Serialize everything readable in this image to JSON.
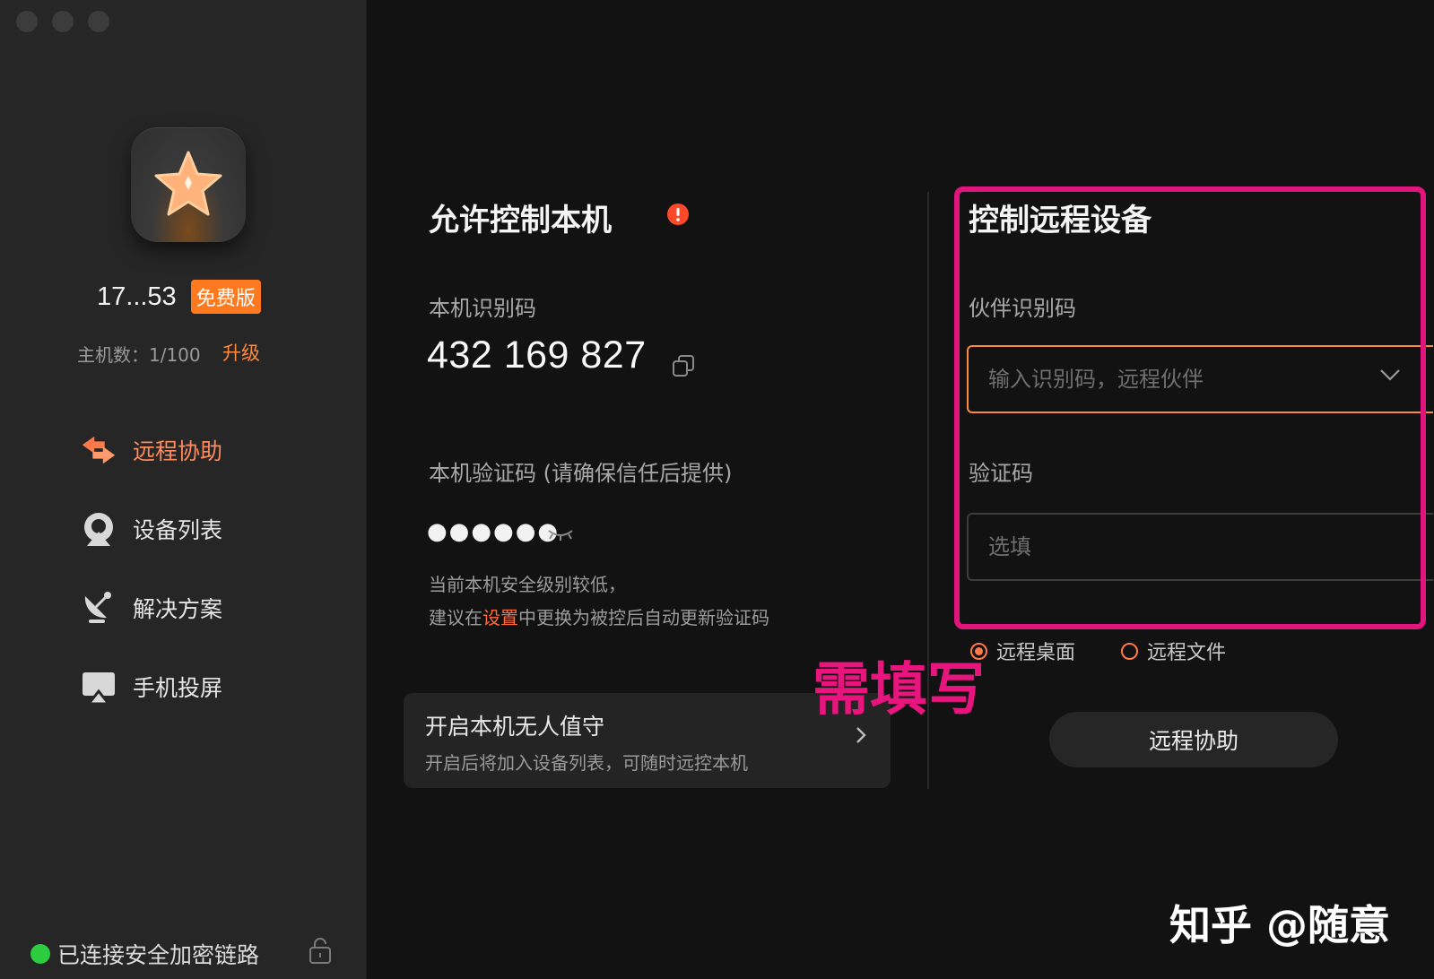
{
  "sidebar": {
    "account": {
      "id": "17...53",
      "plan_badge": "免费版"
    },
    "hosts": {
      "label": "主机数：1/100",
      "upgrade": "升级"
    },
    "nav": [
      {
        "label": "远程协助",
        "icon": "swap-arrows-icon",
        "active": true
      },
      {
        "label": "设备列表",
        "icon": "device-list-icon",
        "active": false
      },
      {
        "label": "解决方案",
        "icon": "satellite-dish-icon",
        "active": false
      },
      {
        "label": "手机投屏",
        "icon": "screen-cast-icon",
        "active": false
      }
    ],
    "status": "已连接安全加密链路"
  },
  "allow": {
    "title": "允许控制本机",
    "id_label": "本机识别码",
    "id_value": "432 169 827",
    "pwd_label": "本机验证码 (请确保信任后提供)",
    "pwd_mask": "●●●●●●",
    "hint_line1": "当前本机安全级别较低，",
    "hint_pre": "建议在",
    "hint_link": "设置",
    "hint_post": "中更换为被控后自动更新验证码",
    "unattended_title": "开启本机无人值守",
    "unattended_sub": "开启后将加入设备列表，可随时远控本机"
  },
  "control": {
    "title": "控制远程设备",
    "partner_label": "伙伴识别码",
    "partner_placeholder": "输入识别码，远程伙伴",
    "code_label": "验证码",
    "code_placeholder": "选填",
    "mode_desktop": "远程桌面",
    "mode_file": "远程文件",
    "submit": "远程协助"
  },
  "annotation": "需填写",
  "watermark": "知乎 @随意",
  "colors": {
    "accent": "#ff7a1f",
    "annotation": "#e0157d",
    "online": "#2ecc40"
  }
}
